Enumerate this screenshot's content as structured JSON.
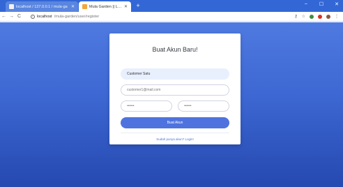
{
  "browser": {
    "tabs": [
      {
        "title": "localhost / 127.0.0.1 / mula-ga",
        "active": false
      },
      {
        "title": "Mula Garden || Login",
        "active": true
      }
    ],
    "new_tab": "+",
    "window_controls": {
      "minimize": "–",
      "maximize": "☐",
      "close": "✕"
    },
    "nav": {
      "back": "←",
      "forward": "→",
      "reload": "C"
    },
    "url": {
      "host": "localhost",
      "path": "/mula-garden/user/register"
    }
  },
  "register": {
    "title": "Buat Akun Baru!",
    "name_value": "Customer Satu",
    "email_placeholder": "customer1@mail.com",
    "password_value": "••••••",
    "repeat_password_value": "••••••",
    "submit_label": "Buat Akun",
    "login_link": "Sudah punya akun? Login!"
  },
  "colors": {
    "chrome": "#3367d6",
    "background_top": "#4f7ae0",
    "background_bottom": "#2549b0",
    "button": "#4e73df"
  }
}
